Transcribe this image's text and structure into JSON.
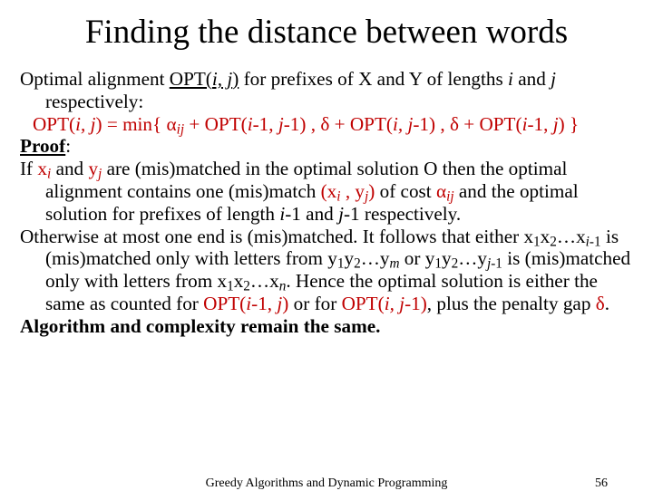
{
  "title": "Finding the distance between words",
  "p1a": "Optimal alignment ",
  "p1b": "OPT(",
  "p1c": "i, j",
  "p1d": ")",
  "p1e": " for prefixes of X and Y of lengths ",
  "p1f": "i",
  "p1g": " and ",
  "p1h": "j",
  "p1i": " respectively:",
  "rec1": "OPT(",
  "rec2": "i, j",
  "rec3": ") = min{ α",
  "rec_sub_ij": "ij",
  "rec4": " + OPT(",
  "rec5": "i",
  "rec6": "-1, ",
  "rec7": "j",
  "rec8": "-1) , δ + OPT(",
  "rec9": "i, j",
  "rec10": "-1) , δ + OPT(",
  "rec11": "i",
  "rec12": "-1, ",
  "rec13": "j",
  "rec14": ") }",
  "proof_label": "Proof",
  "proof_colon": ":",
  "p2a": "If ",
  "p2b": "x",
  "p2b_sub": "i",
  "p2c": " and ",
  "p2d": "y",
  "p2d_sub": "j",
  "p2e": " are (mis)matched in the optimal solution O then the optimal alignment contains one (mis)match ",
  "p2f": "(x",
  "p2f_sub": "i",
  "p2g": " , y",
  "p2g_sub": "j",
  "p2h": ")",
  "p2i": " of cost ",
  "p2j": "α",
  "p2j_sub": "ij",
  "p2k": " and the optimal solution for prefixes of length ",
  "p2l": "i",
  "p2m": "-1 and ",
  "p2n": "j",
  "p2o": "-1 respectively.",
  "p3a": "Otherwise at most one end is (mis)matched. It follows that either x",
  "p3a1": "1",
  "p3b": "x",
  "p3b1": "2",
  "p3c": "…x",
  "p3c1a": "i",
  "p3c1b": "-1",
  "p3d": " is (mis)matched only with letters from y",
  "p3d1": "1",
  "p3e": "y",
  "p3e1": "2",
  "p3f": "…y",
  "p3f1": "m",
  "p3g": " or y",
  "p3g1": "1",
  "p3h": "y",
  "p3h1": "2",
  "p3i": "…y",
  "p3i1a": "j",
  "p3i1b": "-1",
  "p3j": " is (mis)matched only with letters from x",
  "p3j1": "1",
  "p3k": "x",
  "p3k1": "2",
  "p3l": "…x",
  "p3l1": "n",
  "p3m": ". Hence the optimal solution is either the same as counted for ",
  "p3n": "OPT(",
  "p3o": "i",
  "p3p": "-1, ",
  "p3q": "j",
  "p3r": ")",
  "p3s": " or for ",
  "p3t": "OPT(",
  "p3u": "i, j",
  "p3v": "-1)",
  "p3w": ", plus the penalty gap ",
  "p3x": "δ",
  "p3y": ".",
  "alg": "Algorithm and complexity remain the same.",
  "footer_title": "Greedy Algorithms and Dynamic Programming",
  "footer_num": "56"
}
